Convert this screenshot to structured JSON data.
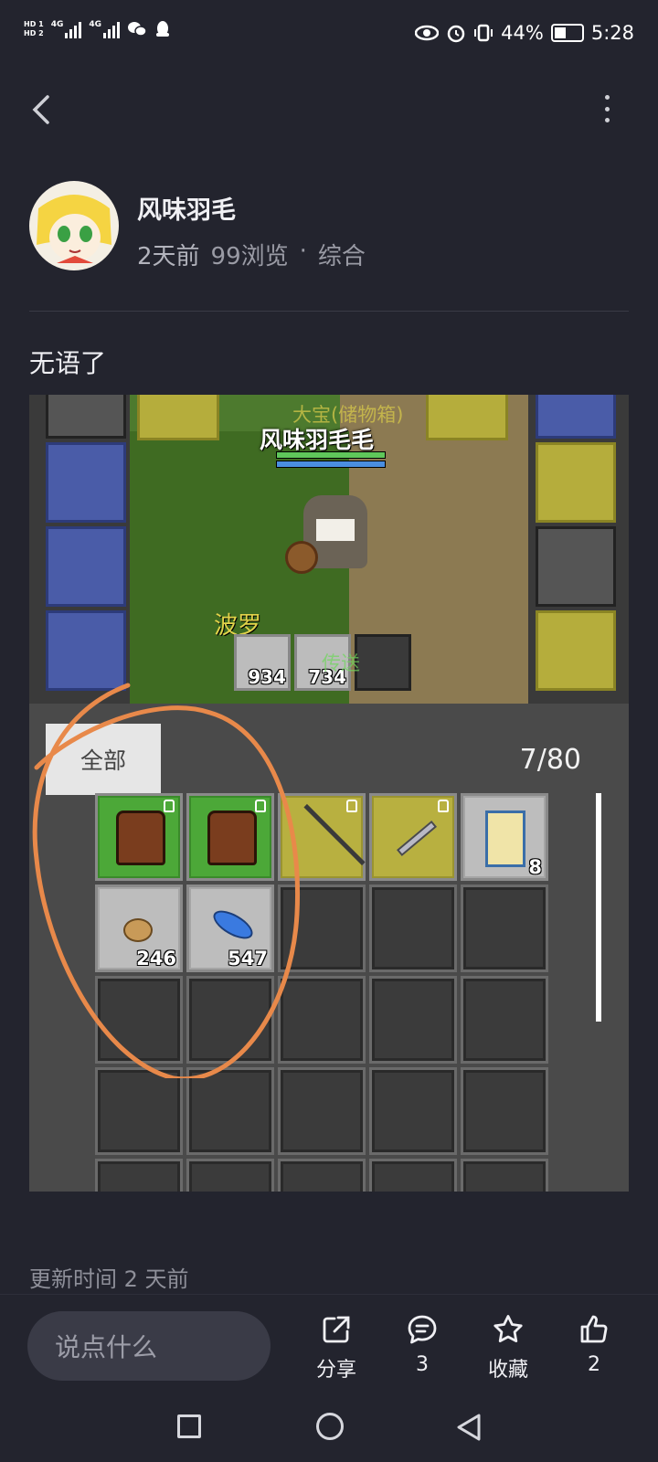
{
  "status_bar": {
    "hd1": "HD 1",
    "hd2": "HD 2",
    "net1": "4G",
    "net2": "4G",
    "battery": "44%",
    "time": "5:28"
  },
  "post": {
    "author": "风味羽毛",
    "time_ago": "2天前",
    "views": "99浏览",
    "separator": "·",
    "category": "综合",
    "text": "无语了",
    "updated": "更新时间 2 天前"
  },
  "game": {
    "chest_label": "大宝(储物箱)",
    "player_name": "风味羽毛毛",
    "npc_name": "波罗",
    "portal_label": "传送",
    "quick_slots": [
      {
        "count": "934"
      },
      {
        "count": "734"
      }
    ],
    "inventory": {
      "tab_label": "全部",
      "capacity": "7/80",
      "items": [
        {
          "name": "armor",
          "count": ""
        },
        {
          "name": "armor",
          "count": ""
        },
        {
          "name": "spear",
          "count": ""
        },
        {
          "name": "sword",
          "count": ""
        },
        {
          "name": "scroll",
          "count": "8"
        },
        {
          "name": "stone",
          "count": "246"
        },
        {
          "name": "feather",
          "count": "547"
        }
      ]
    }
  },
  "actions": {
    "comment_placeholder": "说点什么",
    "share_label": "分享",
    "comment_count": "3",
    "favorite_label": "收藏",
    "like_count": "2"
  },
  "colors": {
    "background": "#23242e",
    "annotation_circle": "#e8894a"
  }
}
